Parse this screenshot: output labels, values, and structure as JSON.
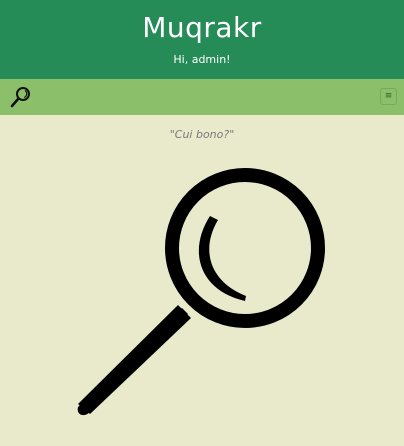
{
  "header": {
    "title": "Muqrakr",
    "greeting": "Hi, admin!",
    "background": "#258b57"
  },
  "toolbar": {
    "background": "#8cbf6a",
    "search_icon": "magnifying-glass-icon",
    "menu_icon": "hamburger-menu-icon",
    "menu_glyph": "≡"
  },
  "main": {
    "quote": "\"Cui bono?\"",
    "hero_icon": "magnifying-glass-icon",
    "background": "#e9e9cc"
  }
}
